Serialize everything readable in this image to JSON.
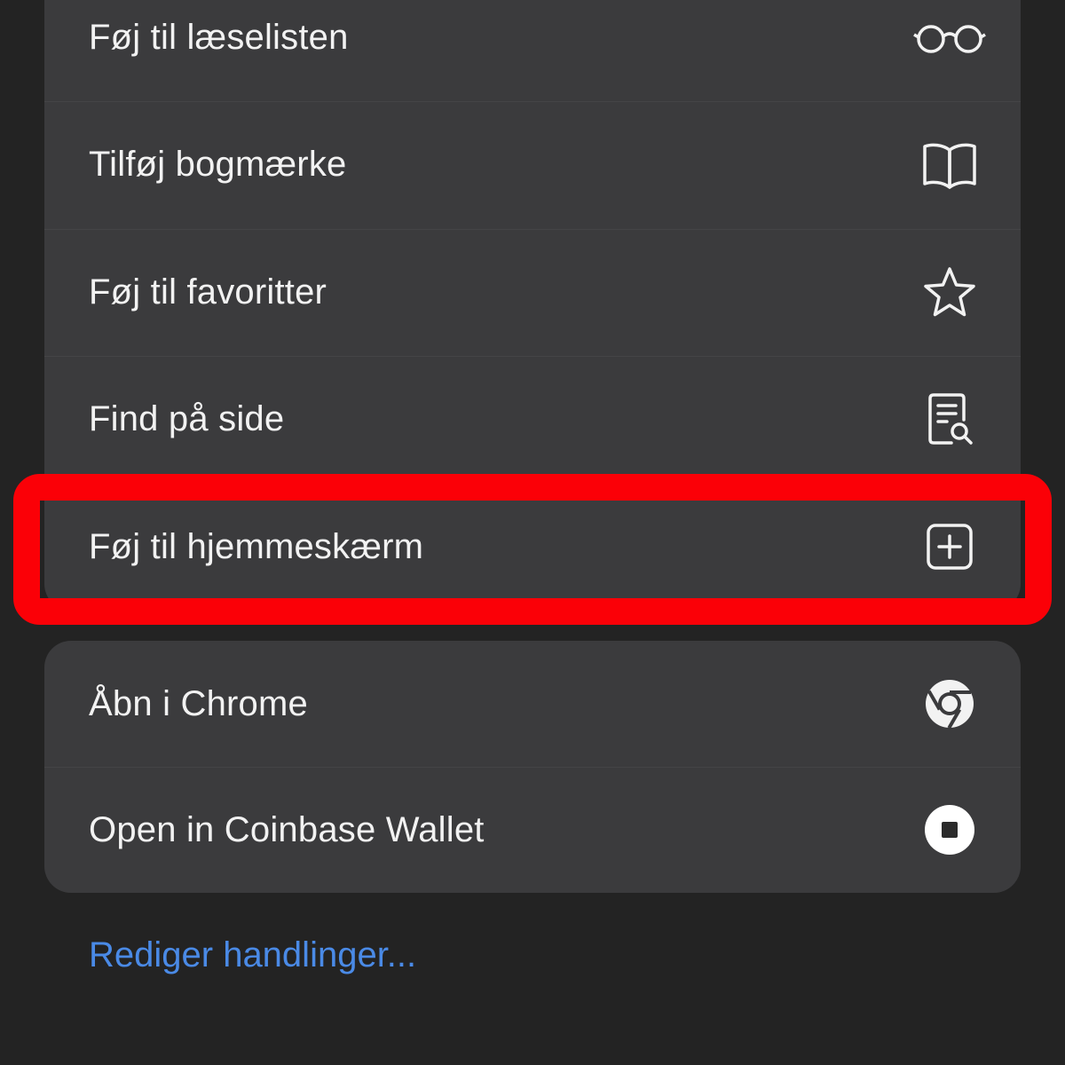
{
  "menu": {
    "items": [
      {
        "label": "Føj til læselisten",
        "icon": "glasses-icon"
      },
      {
        "label": "Tilføj bogmærke",
        "icon": "open-book-icon"
      },
      {
        "label": "Føj til favoritter",
        "icon": "star-icon"
      },
      {
        "label": "Find på side",
        "icon": "find-in-page-icon"
      },
      {
        "label": "Føj til hjemmeskærm",
        "icon": "add-square-icon"
      }
    ],
    "extensions": [
      {
        "label": "Åbn i Chrome",
        "icon": "chrome-icon"
      },
      {
        "label": "Open in Coinbase Wallet",
        "icon": "coinbase-icon"
      }
    ],
    "edit_actions": "Rediger handlinger..."
  },
  "annotation": {
    "highlighted_item": "Føj til hjemmeskærm",
    "color": "#fb0007"
  },
  "colors": {
    "background": "#232323",
    "menu_surface": "#3b3b3d",
    "text": "#f2f2f2",
    "link": "#4a8ae6"
  }
}
